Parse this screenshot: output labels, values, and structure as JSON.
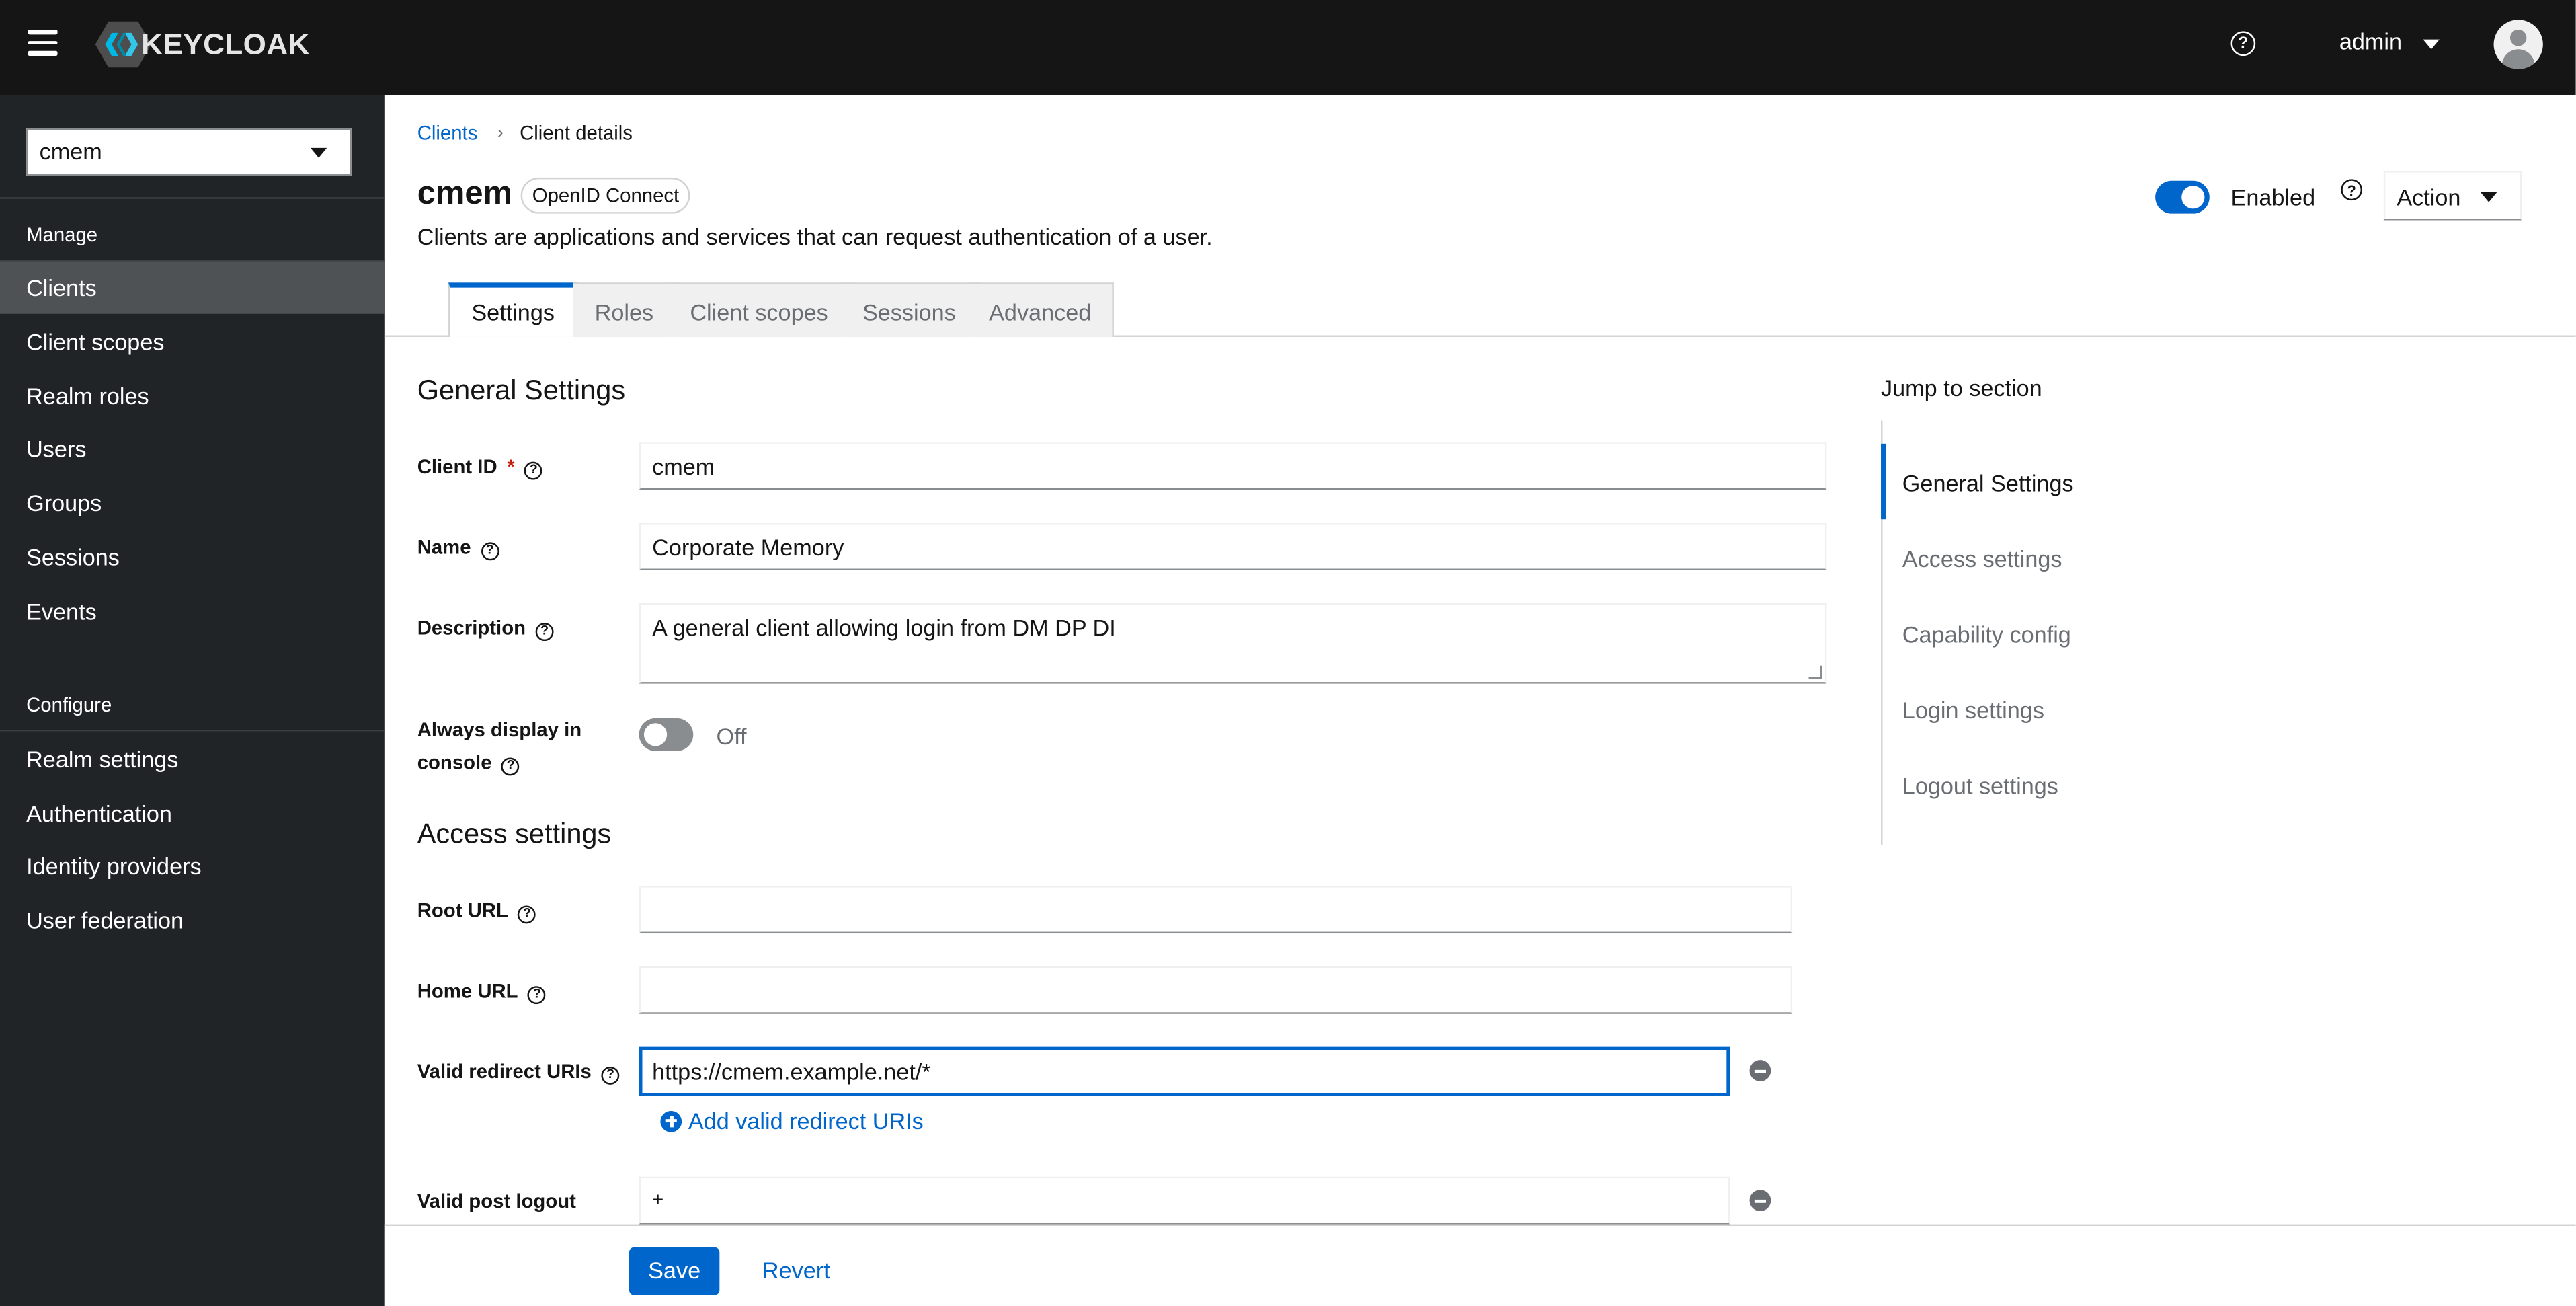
{
  "masthead": {
    "logo_text": "KEYCLOAK",
    "user_label": "admin"
  },
  "sidebar": {
    "realm": "cmem",
    "sections": [
      {
        "label": "Manage",
        "items": [
          "Clients",
          "Client scopes",
          "Realm roles",
          "Users",
          "Groups",
          "Sessions",
          "Events"
        ]
      },
      {
        "label": "Configure",
        "items": [
          "Realm settings",
          "Authentication",
          "Identity providers",
          "User federation"
        ]
      }
    ],
    "active_item": "Clients"
  },
  "breadcrumb": {
    "parent": "Clients",
    "current": "Client details"
  },
  "header": {
    "title": "cmem",
    "badge": "OpenID Connect",
    "description": "Clients are applications and services that can request authentication of a user.",
    "enabled_label": "Enabled",
    "enabled": true,
    "action_label": "Action"
  },
  "tabs": [
    "Settings",
    "Roles",
    "Client scopes",
    "Sessions",
    "Advanced"
  ],
  "active_tab": "Settings",
  "general_settings": {
    "title": "General Settings",
    "client_id_label": "Client ID",
    "required_mark": "*",
    "client_id_value": "cmem",
    "name_label": "Name",
    "name_value": "Corporate Memory",
    "description_label": "Description",
    "description_value": "A general client allowing login from DM DP DI",
    "always_display_label": "Always display in console",
    "always_display_state": "Off"
  },
  "access_settings": {
    "title": "Access settings",
    "root_url_label": "Root URL",
    "root_url_value": "",
    "home_url_label": "Home URL",
    "home_url_value": "",
    "redirect_uris_label": "Valid redirect URIs",
    "redirect_uris_value": "https://cmem.example.net/*",
    "add_redirect_label": "Add valid redirect URIs",
    "post_logout_label": "Valid post logout",
    "post_logout_value": "+"
  },
  "jump_to_section": {
    "title": "Jump to section",
    "items": [
      "General Settings",
      "Access settings",
      "Capability config",
      "Login settings",
      "Logout settings"
    ],
    "active": "General Settings"
  },
  "footer": {
    "save_label": "Save",
    "revert_label": "Revert"
  },
  "colors": {
    "accent": "#0066cc",
    "masthead": "#151515",
    "sidebar": "#212427",
    "sidebar_active": "#4f5255"
  },
  "icons": [
    "menu-icon",
    "keycloak-logo-icon",
    "help-icon",
    "caret-down-icon",
    "avatar-icon",
    "minus-circle-icon",
    "plus-circle-icon"
  ]
}
